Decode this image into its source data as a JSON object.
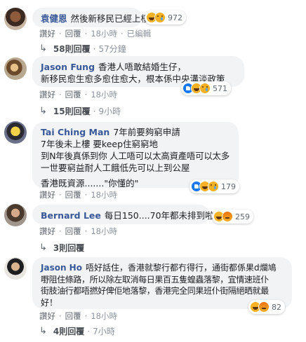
{
  "comments": [
    {
      "author": "袁健恩",
      "text_lines": [
        "然後新移民已經上樓"
      ],
      "react_count": "972",
      "meta": {
        "like": "讚好",
        "reply": "回覆",
        "time": "18小時",
        "edited": "已編輯"
      },
      "replies": {
        "count": "58則回覆",
        "time": "57分鐘"
      }
    },
    {
      "author": "Jason Fung",
      "text_lines": [
        "香港人唔敢結婚生仔，",
        "新移民愈生愈多愈住愈大，根本係中央溝淡政策"
      ],
      "react_count": "571",
      "meta": {
        "like": "讚好",
        "reply": "回覆",
        "time": "18小時"
      },
      "replies": {
        "count": "15則回覆",
        "time": "9小時"
      }
    },
    {
      "author": "Tai Ching Man",
      "text_lines": [
        "7年前要夠窮申請",
        "7年後未上樓 要keep住窮窮地",
        "到N年後真係到你 人工唔可以太高資產唔可以太多",
        "一世要窮益耐人工餓低先可以上到公屋",
        "",
        "香港既資源.......\"你懂的\""
      ],
      "react_count": "179",
      "meta": {
        "like": "讚好",
        "reply": "回覆",
        "time": "18小時"
      },
      "replies": null
    },
    {
      "author": "Bernard Lee",
      "text_lines": [
        "每日150....70年都未排到啦..."
      ],
      "react_count": "259",
      "meta": {
        "like": "讚好",
        "reply": "回覆",
        "time": "18小時"
      },
      "replies": {
        "count": "3則回覆",
        "time": ""
      }
    },
    {
      "author": "Jason Ho",
      "text_lines": [
        "唔好話住，香港就黎行都冇得行，通街都係果d爛鳩",
        "嘢阻住條路，所以除左取消每日果百五隻蝗蟲落黎，宜情速班仆",
        "街肢油行都唔撚好俾佢地落黎，香港完全同果班仆街隔絕晒就最",
        "好！"
      ],
      "react_count": "82",
      "meta": {
        "like": "讚好",
        "reply": "回覆",
        "time": "18小時"
      },
      "replies": {
        "count": "4則回覆",
        "time": "7小時"
      }
    }
  ],
  "colors": {
    "author": "#385898",
    "bubble": "#f2f3f5",
    "meta": "#8d949e",
    "like_blue": "#1877f2",
    "emoji_yellow": "#f7b125"
  },
  "icons": {
    "reply_arrow": "↳",
    "reactions": [
      "like-icon",
      "haha-icon",
      "sad-icon",
      "angry-icon"
    ]
  }
}
